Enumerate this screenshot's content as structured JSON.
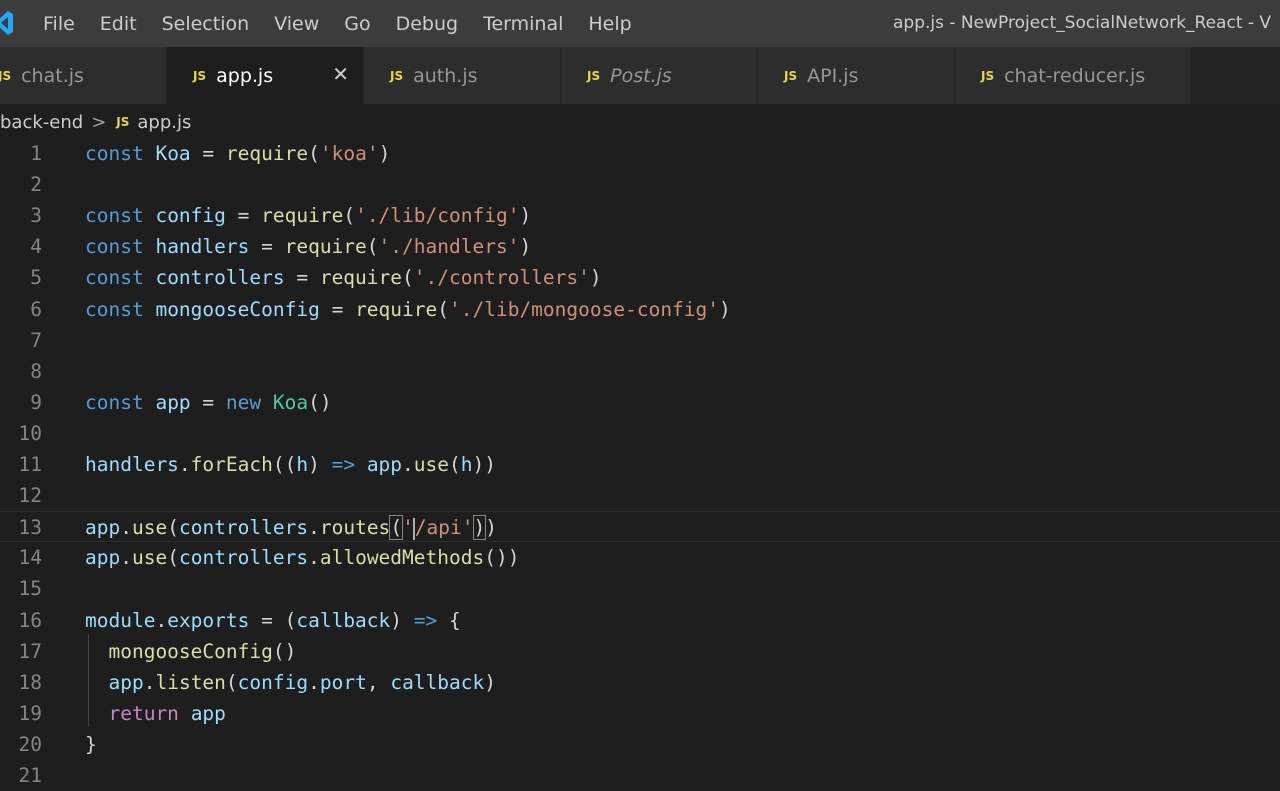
{
  "menu": [
    "File",
    "Edit",
    "Selection",
    "View",
    "Go",
    "Debug",
    "Terminal",
    "Help"
  ],
  "window_title": "app.js - NewProject_SocialNetwork_React - V",
  "tabs": [
    {
      "badge": "JS",
      "label": "chat.js",
      "active": false,
      "italic": false
    },
    {
      "badge": "JS",
      "label": "app.js",
      "active": true,
      "italic": false,
      "close": "✕"
    },
    {
      "badge": "JS",
      "label": "auth.js",
      "active": false,
      "italic": false
    },
    {
      "badge": "JS",
      "label": "Post.js",
      "active": false,
      "italic": true
    },
    {
      "badge": "JS",
      "label": "API.js",
      "active": false,
      "italic": false
    },
    {
      "badge": "JS",
      "label": "chat-reducer.js",
      "active": false,
      "italic": false
    }
  ],
  "breadcrumb": {
    "folder": "back-end",
    "separator": ">",
    "badge": "JS",
    "file": "app.js"
  },
  "colors": {
    "keyword": "#569cd6",
    "variable": "#9cdcfe",
    "function": "#dcdcaa",
    "class": "#4ec9b0",
    "string": "#ce9178",
    "js_badge": "#e8d44d"
  },
  "editor": {
    "line_numbers": [
      "1",
      "2",
      "3",
      "4",
      "5",
      "6",
      "7",
      "8",
      "9",
      "10",
      "11",
      "12",
      "13",
      "14",
      "15",
      "16",
      "17",
      "18",
      "19",
      "20",
      "21"
    ],
    "lines": [
      {
        "n": "1",
        "tokens": [
          [
            "k",
            "const"
          ],
          [
            "p",
            " "
          ],
          [
            "v",
            "Koa"
          ],
          [
            "p",
            " = "
          ],
          [
            "f",
            "require"
          ],
          [
            "p",
            "("
          ],
          [
            "s",
            "'koa'"
          ],
          [
            "p",
            ")"
          ]
        ]
      },
      {
        "n": "2",
        "tokens": []
      },
      {
        "n": "3",
        "tokens": [
          [
            "k",
            "const"
          ],
          [
            "p",
            " "
          ],
          [
            "v",
            "config"
          ],
          [
            "p",
            " = "
          ],
          [
            "f",
            "require"
          ],
          [
            "p",
            "("
          ],
          [
            "s",
            "'./lib/config'"
          ],
          [
            "p",
            ")"
          ]
        ]
      },
      {
        "n": "4",
        "tokens": [
          [
            "k",
            "const"
          ],
          [
            "p",
            " "
          ],
          [
            "v",
            "handlers"
          ],
          [
            "p",
            " = "
          ],
          [
            "f",
            "require"
          ],
          [
            "p",
            "("
          ],
          [
            "s",
            "'./handlers'"
          ],
          [
            "p",
            ")"
          ]
        ]
      },
      {
        "n": "5",
        "tokens": [
          [
            "k",
            "const"
          ],
          [
            "p",
            " "
          ],
          [
            "v",
            "controllers"
          ],
          [
            "p",
            " = "
          ],
          [
            "f",
            "require"
          ],
          [
            "p",
            "("
          ],
          [
            "s",
            "'./controllers'"
          ],
          [
            "p",
            ")"
          ]
        ]
      },
      {
        "n": "6",
        "tokens": [
          [
            "k",
            "const"
          ],
          [
            "p",
            " "
          ],
          [
            "v",
            "mongooseConfig"
          ],
          [
            "p",
            " = "
          ],
          [
            "f",
            "require"
          ],
          [
            "p",
            "("
          ],
          [
            "s",
            "'./lib/mongoose-config'"
          ],
          [
            "p",
            ")"
          ]
        ]
      },
      {
        "n": "7",
        "tokens": []
      },
      {
        "n": "8",
        "tokens": []
      },
      {
        "n": "9",
        "tokens": [
          [
            "k",
            "const"
          ],
          [
            "p",
            " "
          ],
          [
            "v",
            "app"
          ],
          [
            "p",
            " = "
          ],
          [
            "k",
            "new"
          ],
          [
            "p",
            " "
          ],
          [
            "c",
            "Koa"
          ],
          [
            "p",
            "()"
          ]
        ]
      },
      {
        "n": "10",
        "tokens": []
      },
      {
        "n": "11",
        "tokens": [
          [
            "v",
            "handlers"
          ],
          [
            "p",
            "."
          ],
          [
            "f",
            "forEach"
          ],
          [
            "p",
            "(("
          ],
          [
            "v",
            "h"
          ],
          [
            "p",
            ") "
          ],
          [
            "k",
            "=>"
          ],
          [
            "p",
            " "
          ],
          [
            "v",
            "app"
          ],
          [
            "p",
            "."
          ],
          [
            "f",
            "use"
          ],
          [
            "p",
            "("
          ],
          [
            "v",
            "h"
          ],
          [
            "p",
            "))"
          ]
        ]
      },
      {
        "n": "12",
        "tokens": []
      },
      {
        "n": "13",
        "tokens": [
          [
            "v",
            "app"
          ],
          [
            "p",
            "."
          ],
          [
            "f",
            "use"
          ],
          [
            "p",
            "("
          ],
          [
            "v",
            "controllers"
          ],
          [
            "p",
            "."
          ],
          [
            "f",
            "routes"
          ],
          [
            "bm",
            "("
          ],
          [
            "s",
            "'"
          ],
          [
            "cur",
            ""
          ],
          [
            "s",
            "/api'"
          ],
          [
            "bm",
            ")"
          ],
          [
            "p",
            ")"
          ]
        ]
      },
      {
        "n": "14",
        "tokens": [
          [
            "v",
            "app"
          ],
          [
            "p",
            "."
          ],
          [
            "f",
            "use"
          ],
          [
            "p",
            "("
          ],
          [
            "v",
            "controllers"
          ],
          [
            "p",
            "."
          ],
          [
            "f",
            "allowedMethods"
          ],
          [
            "p",
            "())"
          ]
        ]
      },
      {
        "n": "15",
        "tokens": []
      },
      {
        "n": "16",
        "tokens": [
          [
            "v",
            "module"
          ],
          [
            "p",
            "."
          ],
          [
            "v",
            "exports"
          ],
          [
            "p",
            " = ("
          ],
          [
            "v",
            "callback"
          ],
          [
            "p",
            ") "
          ],
          [
            "k",
            "=>"
          ],
          [
            "p",
            " {"
          ]
        ]
      },
      {
        "n": "17",
        "tokens": [
          [
            "p",
            "  "
          ],
          [
            "f",
            "mongooseConfig"
          ],
          [
            "p",
            "()"
          ]
        ]
      },
      {
        "n": "18",
        "tokens": [
          [
            "p",
            "  "
          ],
          [
            "v",
            "app"
          ],
          [
            "p",
            "."
          ],
          [
            "f",
            "listen"
          ],
          [
            "p",
            "("
          ],
          [
            "v",
            "config"
          ],
          [
            "p",
            "."
          ],
          [
            "v",
            "port"
          ],
          [
            "p",
            ", "
          ],
          [
            "v",
            "callback"
          ],
          [
            "p",
            ")"
          ]
        ]
      },
      {
        "n": "19",
        "tokens": [
          [
            "p",
            "  "
          ],
          [
            "r",
            "return"
          ],
          [
            "p",
            " "
          ],
          [
            "v",
            "app"
          ]
        ]
      },
      {
        "n": "20",
        "tokens": [
          [
            "p",
            "}"
          ]
        ]
      },
      {
        "n": "21",
        "tokens": []
      }
    ]
  }
}
